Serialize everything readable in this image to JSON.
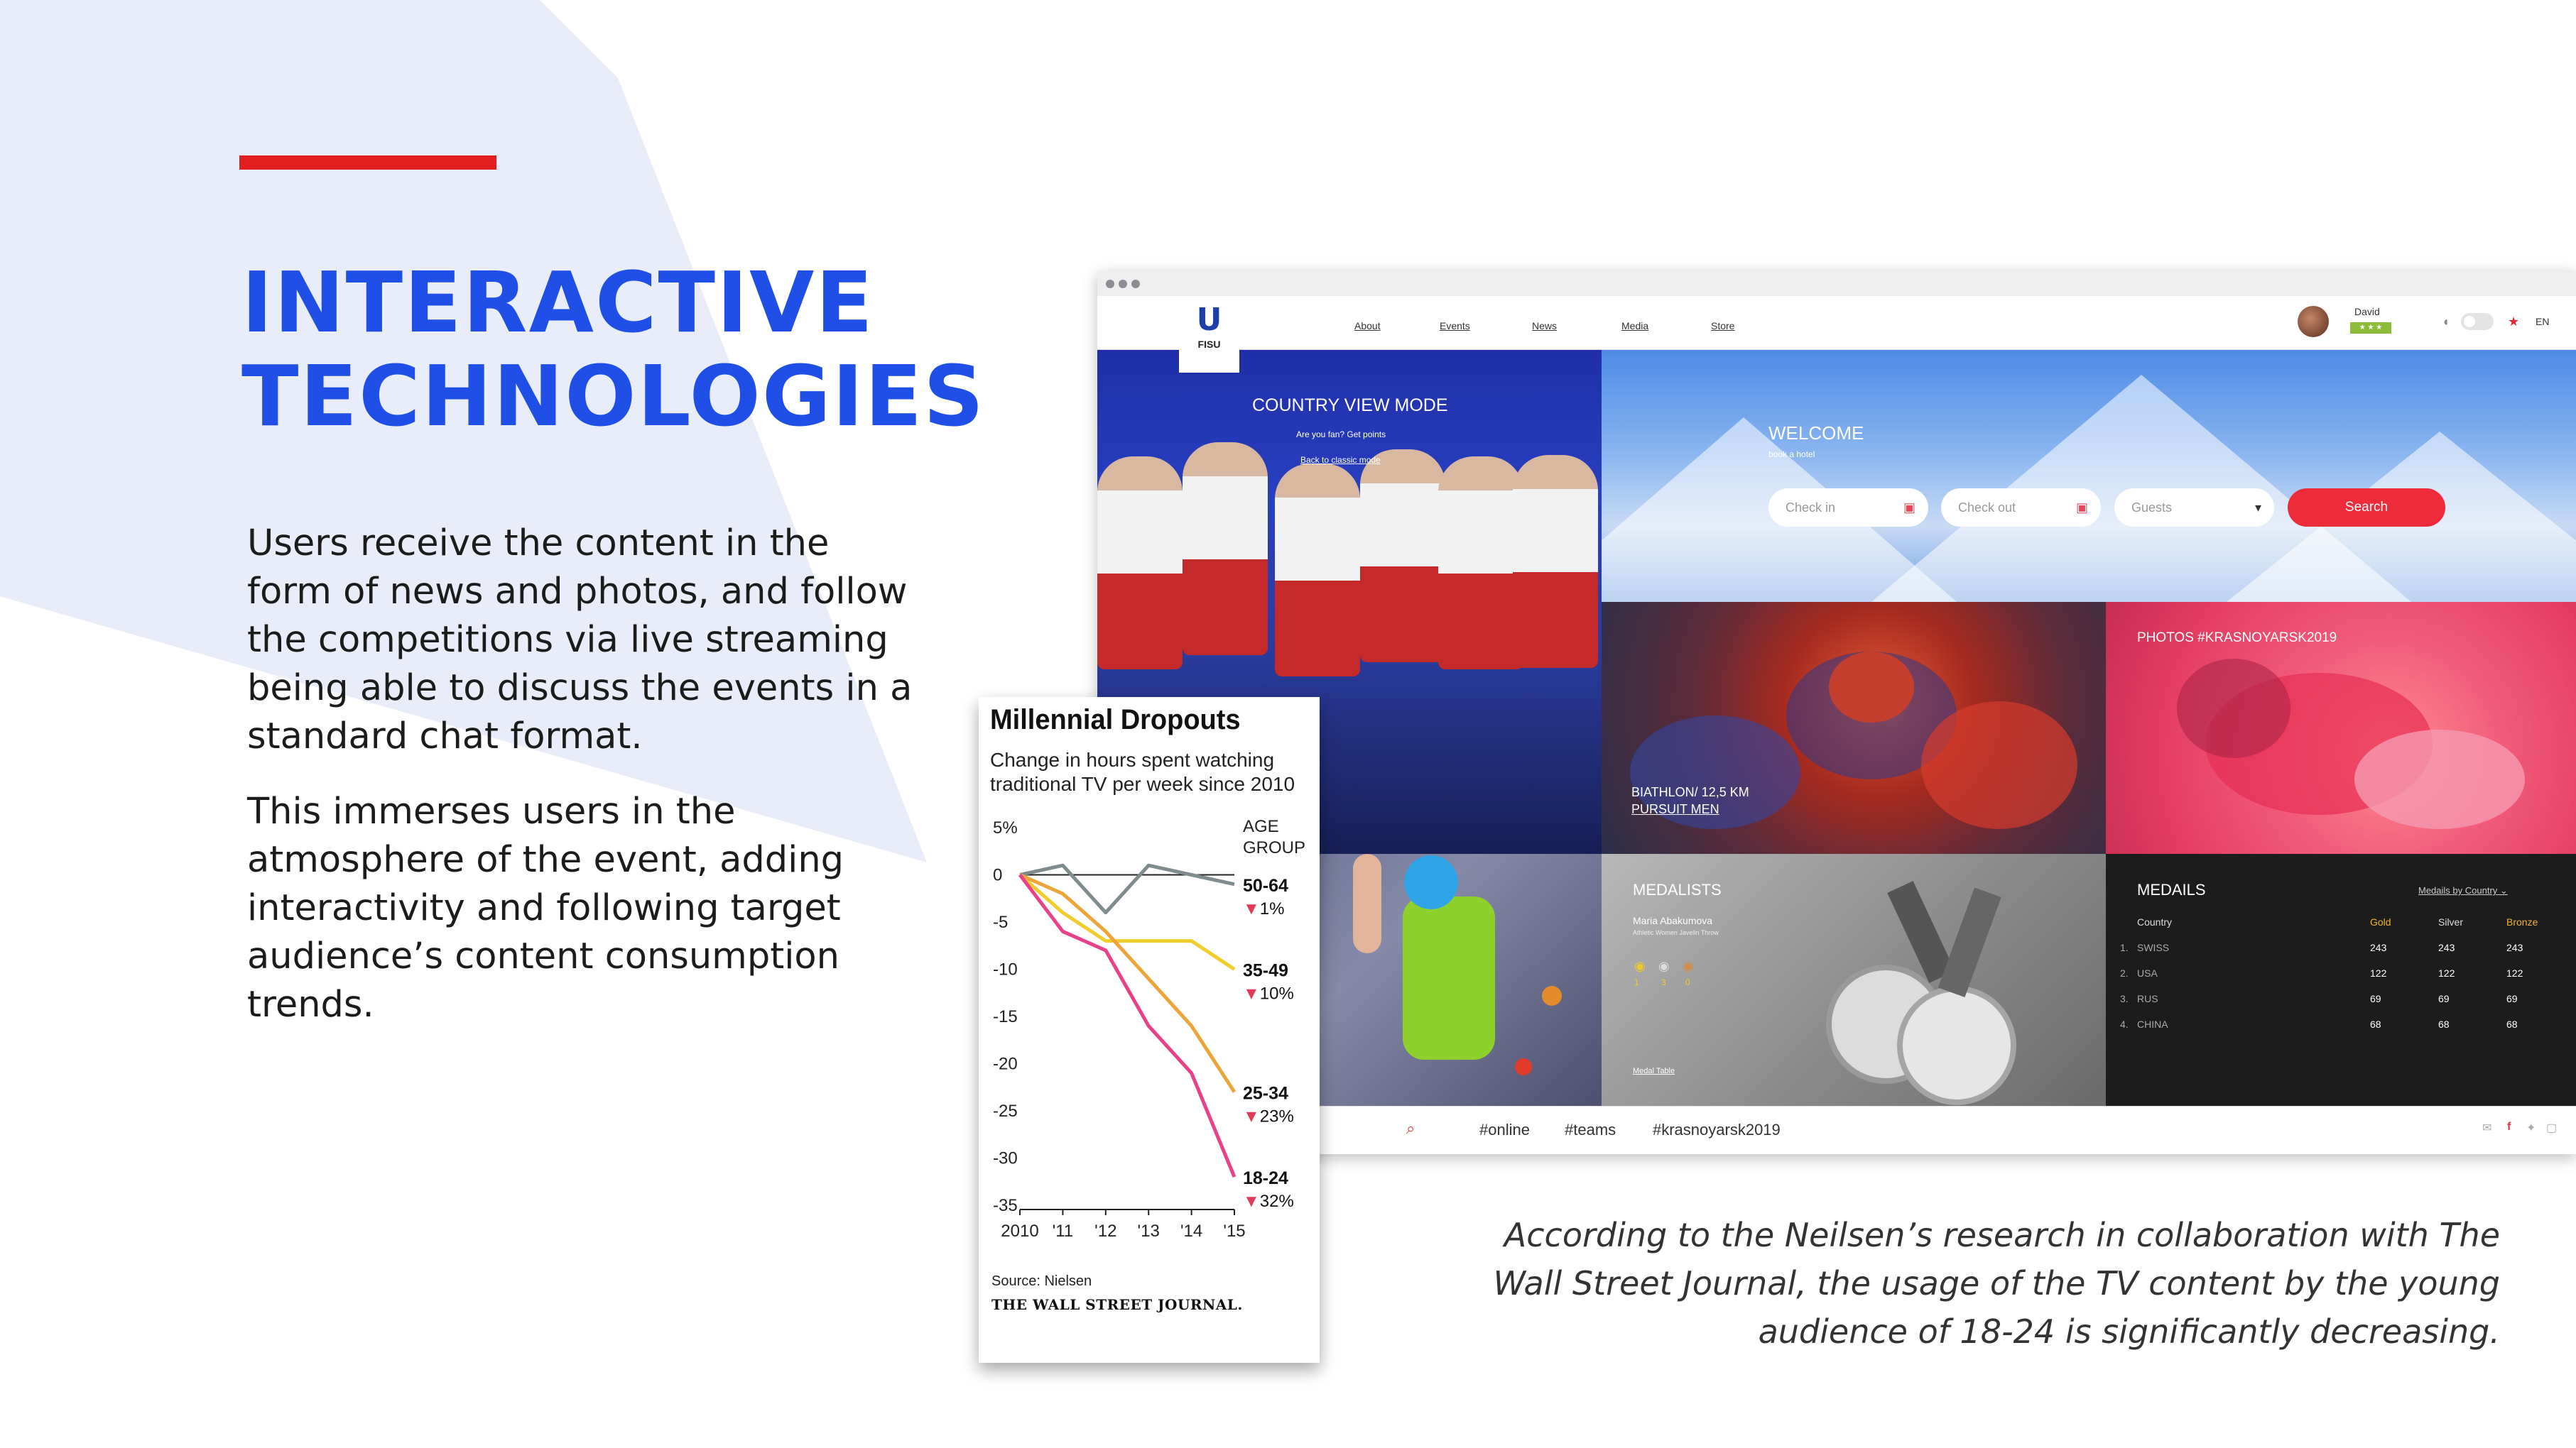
{
  "slide": {
    "title_line1": "INTERACTIVE",
    "title_line2": "TECHNOLOGIES",
    "paragraph1_lines": [
      "Users receive the content in the",
      "form of news and photos, and follow",
      "the competitions via live streaming",
      "being able to discuss the events in a",
      "standard chat format."
    ],
    "paragraph2_lines": [
      "This immerses users in the",
      "atmosphere of the event, adding",
      "interactivity and following target",
      "audience’s content consumption",
      "trends."
    ],
    "caption_lines": [
      "According to the Neilsen’s research in collaboration with The",
      "Wall Street Journal, the usage of the TV  content by the young",
      "audience of 18-24 is significantly decreasing."
    ],
    "colors": {
      "accent_blue": "#1f4fe6",
      "accent_red": "#e21f1f",
      "background_shape": "#e8ebf8"
    }
  },
  "browser": {
    "logo": {
      "letter": "U",
      "text": "FISU"
    },
    "nav": [
      "About",
      "Events",
      "News",
      "Media",
      "Store"
    ],
    "user": {
      "name": "David",
      "badge": "★ ★ ★"
    },
    "language": "EN",
    "country_panel": {
      "title": "COUNTRY VIEW MODE",
      "line1": "Are you fan? Get points",
      "line2": "Back to classic mode"
    },
    "welcome_panel": {
      "title": "WELCOME",
      "subtitle": "book a hotel",
      "checkin_placeholder": "Check in",
      "checkout_placeholder": "Check out",
      "guests_placeholder": "Guests",
      "search_label": "Search"
    },
    "biathlon_panel": {
      "line1": "BIATHLON/ 12,5 KM",
      "line2": "PURSUIT MEN"
    },
    "photos_panel": {
      "title": "PHOTOS #KRASNOYARSK2019"
    },
    "medalists_panel": {
      "title": "MEDALISTS",
      "name": "Maria Abakumova",
      "event": "Athletic Women Javelin Throw",
      "counts": [
        "1",
        "3",
        "0"
      ],
      "link": "Medal Table"
    },
    "medails_panel": {
      "title": "MEDAILS",
      "filter": "Medails by Country ⌄",
      "headers": [
        "Country",
        "Gold",
        "Silver",
        "Bronze"
      ],
      "rows": [
        {
          "rank": "1.",
          "country": "SWISS",
          "gold": "243",
          "silver": "243",
          "bronze": "243"
        },
        {
          "rank": "2.",
          "country": "USA",
          "gold": "122",
          "silver": "122",
          "bronze": "122"
        },
        {
          "rank": "3.",
          "country": "RUS",
          "gold": "69",
          "silver": "69",
          "bronze": "69"
        },
        {
          "rank": "4.",
          "country": "CHINA",
          "gold": "68",
          "silver": "68",
          "bronze": "68"
        }
      ]
    },
    "bottom_bar": {
      "hashtags": [
        "#online",
        "#teams",
        "#krasnoyarsk2019"
      ]
    }
  },
  "chart_data": {
    "type": "line",
    "title": "Millennial Dropouts",
    "subtitle": "Change in hours spent watching traditional TV per week since 2010",
    "legend_title": "AGE GROUP",
    "x": [
      "2010",
      "'11",
      "'12",
      "'13",
      "'14",
      "'15"
    ],
    "ylim": [
      -35,
      5
    ],
    "y_ticks": [
      "5%",
      "0",
      "-5",
      "-10",
      "-15",
      "-20",
      "-25",
      "-30",
      "-35"
    ],
    "series": [
      {
        "name": "50-64",
        "change": "▼1%",
        "color": "#7f8c8d",
        "values": [
          0,
          1,
          -4,
          1,
          0,
          -1
        ]
      },
      {
        "name": "35-49",
        "change": "▼10%",
        "color": "#f1cd2c",
        "values": [
          0,
          -4,
          -7,
          -7,
          -7,
          -10
        ]
      },
      {
        "name": "25-34",
        "change": "▼23%",
        "color": "#eda53a",
        "values": [
          0,
          -2,
          -6,
          -11,
          -16,
          -23
        ]
      },
      {
        "name": "18-24",
        "change": "▼32%",
        "color": "#e9408a",
        "values": [
          0,
          -6,
          -8,
          -16,
          -21,
          -32
        ]
      }
    ],
    "source": "Source: Nielsen",
    "publisher": "THE WALL STREET JOURNAL."
  }
}
